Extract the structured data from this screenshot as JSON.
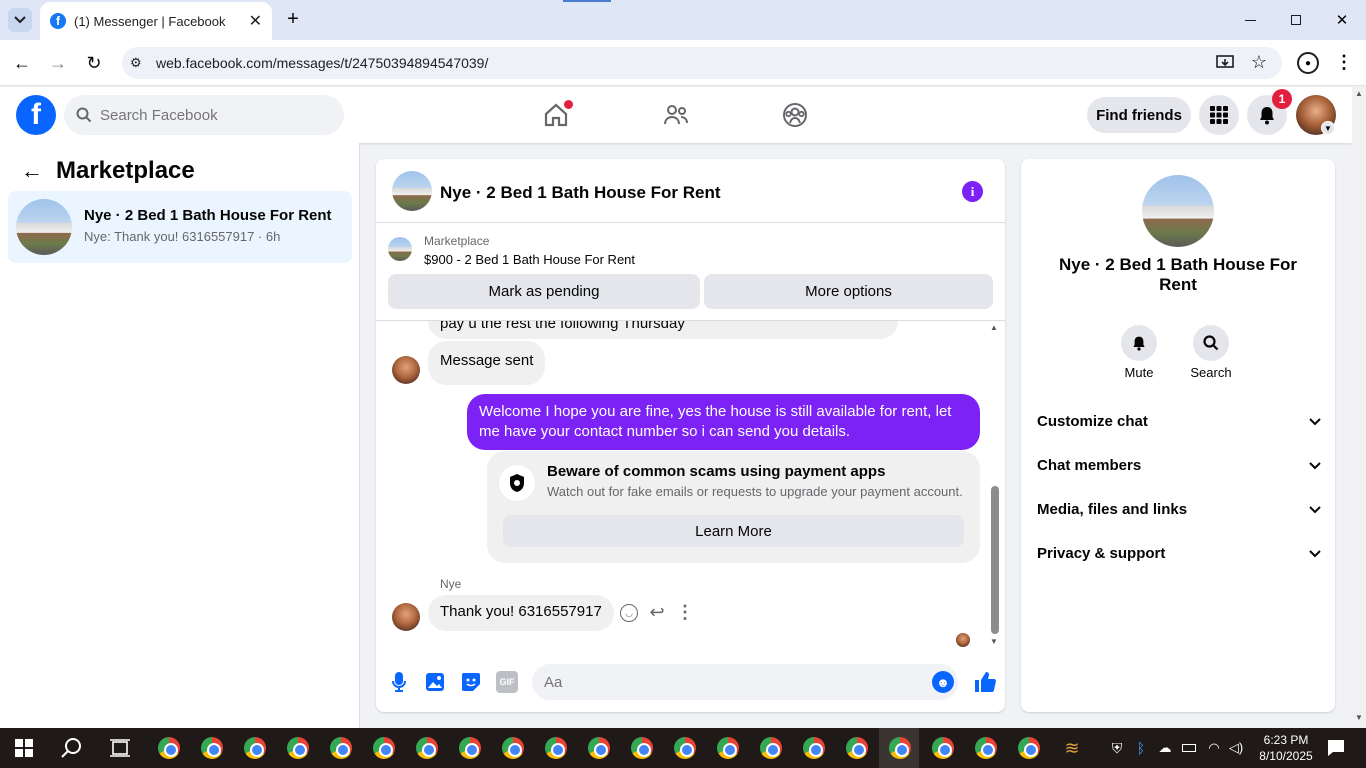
{
  "browser": {
    "tab_title": "(1) Messenger | Facebook",
    "url": "web.facebook.com/messages/t/24750394894547039/"
  },
  "fb_nav": {
    "search_placeholder": "Search Facebook",
    "find_friends": "Find friends",
    "notification_count": "1"
  },
  "left": {
    "title": "Marketplace",
    "conversation": {
      "title": "Nye · 2 Bed 1 Bath House For Rent",
      "preview": "Nye: Thank you! 6316557917 · 6h"
    }
  },
  "chat": {
    "header_title": "Nye · 2 Bed 1 Bath House For Rent",
    "listing": {
      "label": "Marketplace",
      "title": "$900 - 2 Bed 1 Bath House For Rent"
    },
    "mark_pending": "Mark as pending",
    "more_options": "More options",
    "messages": {
      "partial": "pay u the rest the following Thursday",
      "sent_note": "Message sent",
      "outgoing": "Welcome I hope you are fine, yes the house is still available for rent, let me have your contact number so i can send you  details.",
      "scam_title": "Beware of common scams using payment apps",
      "scam_body": "Watch out for fake emails or requests to upgrade your payment account.",
      "learn_more": "Learn More",
      "sender_name": "Nye",
      "incoming": "Thank you! 6316557917"
    },
    "composer_placeholder": "Aa",
    "accent": "#7c22f5"
  },
  "info": {
    "title": "Nye · 2 Bed 1 Bath House For Rent",
    "mute": "Mute",
    "search": "Search",
    "sections": [
      "Customize chat",
      "Chat members",
      "Media, files and links",
      "Privacy & support"
    ]
  },
  "taskbar": {
    "time": "6:23 PM",
    "date": "8/10/2025"
  }
}
